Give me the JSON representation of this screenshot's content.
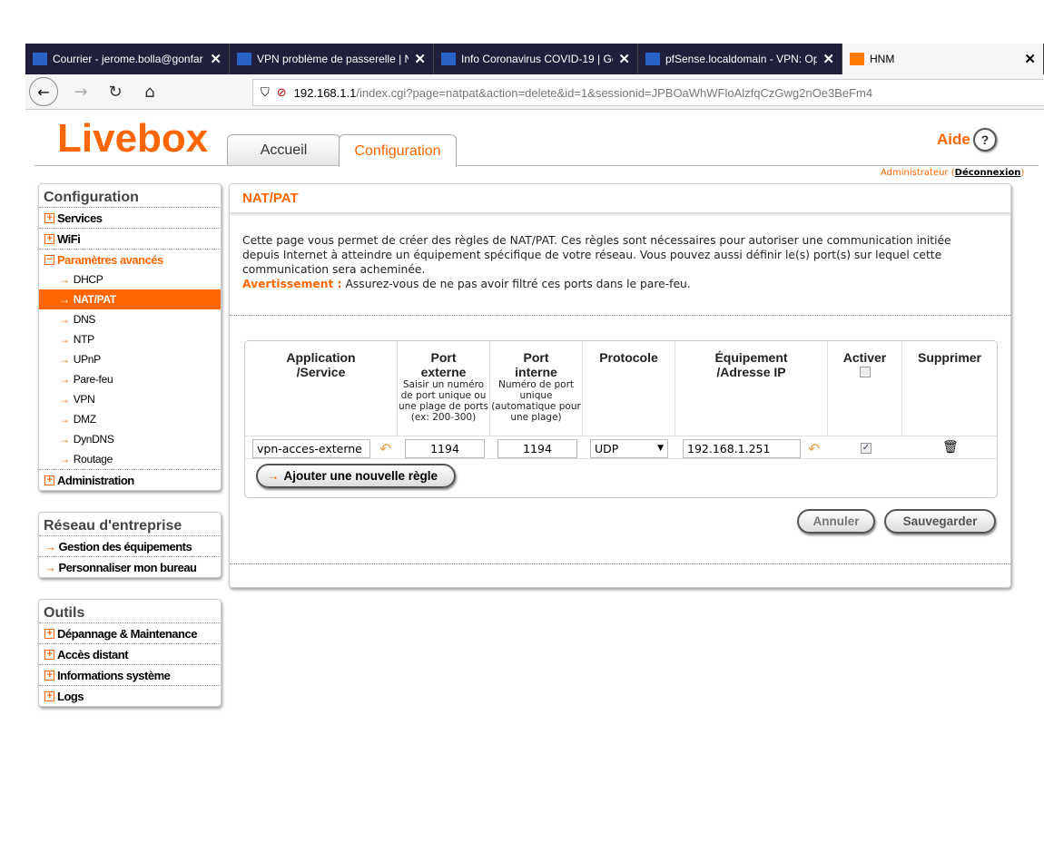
{
  "browser": {
    "tabs": [
      {
        "title": "Courrier - jerome.bolla@gonfar",
        "icon": "outlook-icon"
      },
      {
        "title": "VPN problème de passerelle | N",
        "icon": "forum-icon"
      },
      {
        "title": "Info Coronavirus COVID-19 | Go",
        "icon": "gov-icon"
      },
      {
        "title": "pfSense.localdomain - VPN: Op",
        "icon": "pfsense-icon"
      },
      {
        "title": "HNM",
        "icon": "orange-icon"
      }
    ],
    "url_host": "192.168.1.1",
    "url_path": "/index.cgi?page=natpat&action=delete&id=1&sessionid=JPBOaWhWFloAlzfqCzGwg2nOe3BeFm4"
  },
  "header": {
    "logo": "Livebox",
    "tabs": [
      "Accueil",
      "Configuration"
    ],
    "active_tab": "Configuration",
    "help": "Aide",
    "help_symbol": "?",
    "user": "Administrateur",
    "logout": "Déconnexion"
  },
  "sidebar": {
    "config": {
      "title": "Configuration",
      "items": [
        "Services",
        "WiFi",
        "Paramètres avancés"
      ],
      "sub": [
        "DHCP",
        "NAT/PAT",
        "DNS",
        "NTP",
        "UPnP",
        "Pare-feu",
        "VPN",
        "DMZ",
        "DynDNS",
        "Routage"
      ],
      "selected": "NAT/PAT",
      "last": "Administration"
    },
    "reseau": {
      "title": "Réseau d'entreprise",
      "items": [
        "Gestion des équipements",
        "Personnaliser mon bureau"
      ]
    },
    "outils": {
      "title": "Outils",
      "items": [
        "Dépannage & Maintenance",
        "Accès distant",
        "Informations système",
        "Logs"
      ]
    }
  },
  "main": {
    "title": "NAT/PAT",
    "desc": "Cette page vous permet de créer des règles de NAT/PAT. Ces règles sont nécessaires pour autoriser une communication initiée depuis Internet à atteindre un équipement spécifique de votre réseau. Vous pouvez aussi définir le(s) port(s) sur lequel cette communication sera acheminée.",
    "warn_label": "Avertissement :",
    "warn_text": " Assurez-vous de ne pas avoir filtré ces ports dans le pare-feu.",
    "columns": [
      {
        "title": "Application /Service",
        "hint": ""
      },
      {
        "title": "Port externe",
        "hint": "Saisir un numéro de port unique ou une plage de ports (ex: 200-300)"
      },
      {
        "title": "Port interne",
        "hint": "Numéro de port unique (automatique pour une plage)"
      },
      {
        "title": "Protocole",
        "hint": ""
      },
      {
        "title": "Équipement /Adresse IP",
        "hint": ""
      },
      {
        "title": "Activer",
        "hint": ""
      },
      {
        "title": "Supprimer",
        "hint": ""
      }
    ],
    "rule": {
      "service": "vpn-acces-externe",
      "ext_port": "1194",
      "int_port": "1194",
      "protocol": "UDP",
      "ip": "192.168.1.251",
      "enabled": true
    },
    "add_rule": "Ajouter une nouvelle règle",
    "cancel": "Annuler",
    "save": "Sauvegarder"
  },
  "colors": {
    "accent": "#ff6600"
  }
}
